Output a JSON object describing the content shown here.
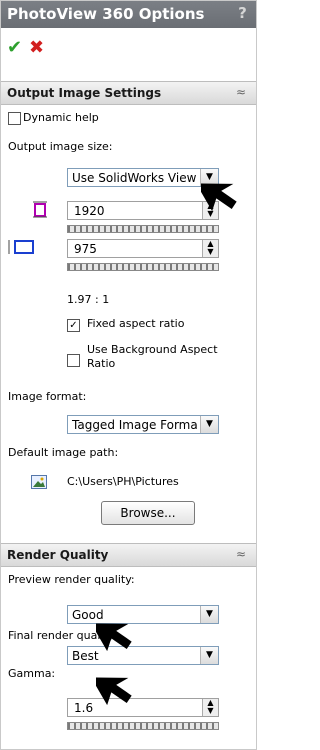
{
  "window": {
    "title": "PhotoView 360 Options",
    "help_label": "?"
  },
  "actions": {
    "ok_glyph": "✔",
    "cancel_glyph": "✖"
  },
  "output": {
    "header": "Output Image Settings",
    "dynamic_help": "Dynamic help",
    "size_label": "Output image size:",
    "size_value": "Use SolidWorks View",
    "width": "1920",
    "height": "975",
    "ratio": "1.97 : 1",
    "fixed_aspect": "Fixed aspect ratio",
    "bg_aspect": "Use Background Aspect Ratio",
    "format_label": "Image format:",
    "format_value": "Tagged Image Forma",
    "path_label": "Default image path:",
    "path_value": "C:\\Users\\PH\\Pictures",
    "browse": "Browse..."
  },
  "render": {
    "header": "Render Quality",
    "preview_label": "Preview render quality:",
    "preview_value": "Good",
    "final_label": "Final render quality:",
    "final_value": "Best",
    "gamma_label": "Gamma:",
    "gamma_value": "1.6"
  }
}
